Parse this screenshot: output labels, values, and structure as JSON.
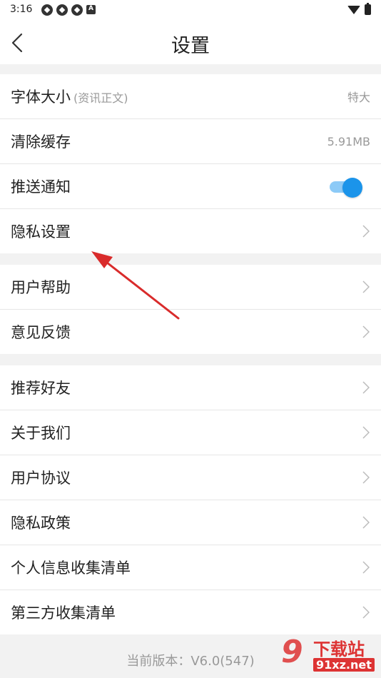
{
  "status_bar": {
    "time": "3:16",
    "left_icons": [
      "notification-icon",
      "notification-icon",
      "notification-icon",
      "a-icon"
    ],
    "right_icons": [
      "wifi-icon",
      "battery-icon"
    ]
  },
  "header": {
    "title": "设置",
    "back_icon": "chevron-left-icon"
  },
  "groups": [
    {
      "rows": [
        {
          "label": "字体大小",
          "sub": "(资讯正文)",
          "value": "特大"
        },
        {
          "label": "清除缓存",
          "value": "5.91MB"
        },
        {
          "label": "推送通知",
          "toggle": true
        },
        {
          "label": "隐私设置",
          "chevron": true
        }
      ]
    },
    {
      "rows": [
        {
          "label": "用户帮助",
          "chevron": true
        },
        {
          "label": "意见反馈",
          "chevron": true
        }
      ]
    },
    {
      "rows": [
        {
          "label": "推荐好友",
          "chevron": true
        },
        {
          "label": "关于我们",
          "chevron": true
        },
        {
          "label": "用户协议",
          "chevron": true
        },
        {
          "label": "隐私政策",
          "chevron": true
        },
        {
          "label": "个人信息收集清单",
          "chevron": true
        },
        {
          "label": "第三方收集清单",
          "chevron": true
        }
      ]
    }
  ],
  "version": "当前版本：V6.0(547)",
  "watermark": {
    "big": "9",
    "line1": "下载站",
    "line2": "91xz.net"
  },
  "colors": {
    "accent": "#1b94ea",
    "annotation_arrow": "#d92b2b",
    "background": "#f2f2f2"
  }
}
